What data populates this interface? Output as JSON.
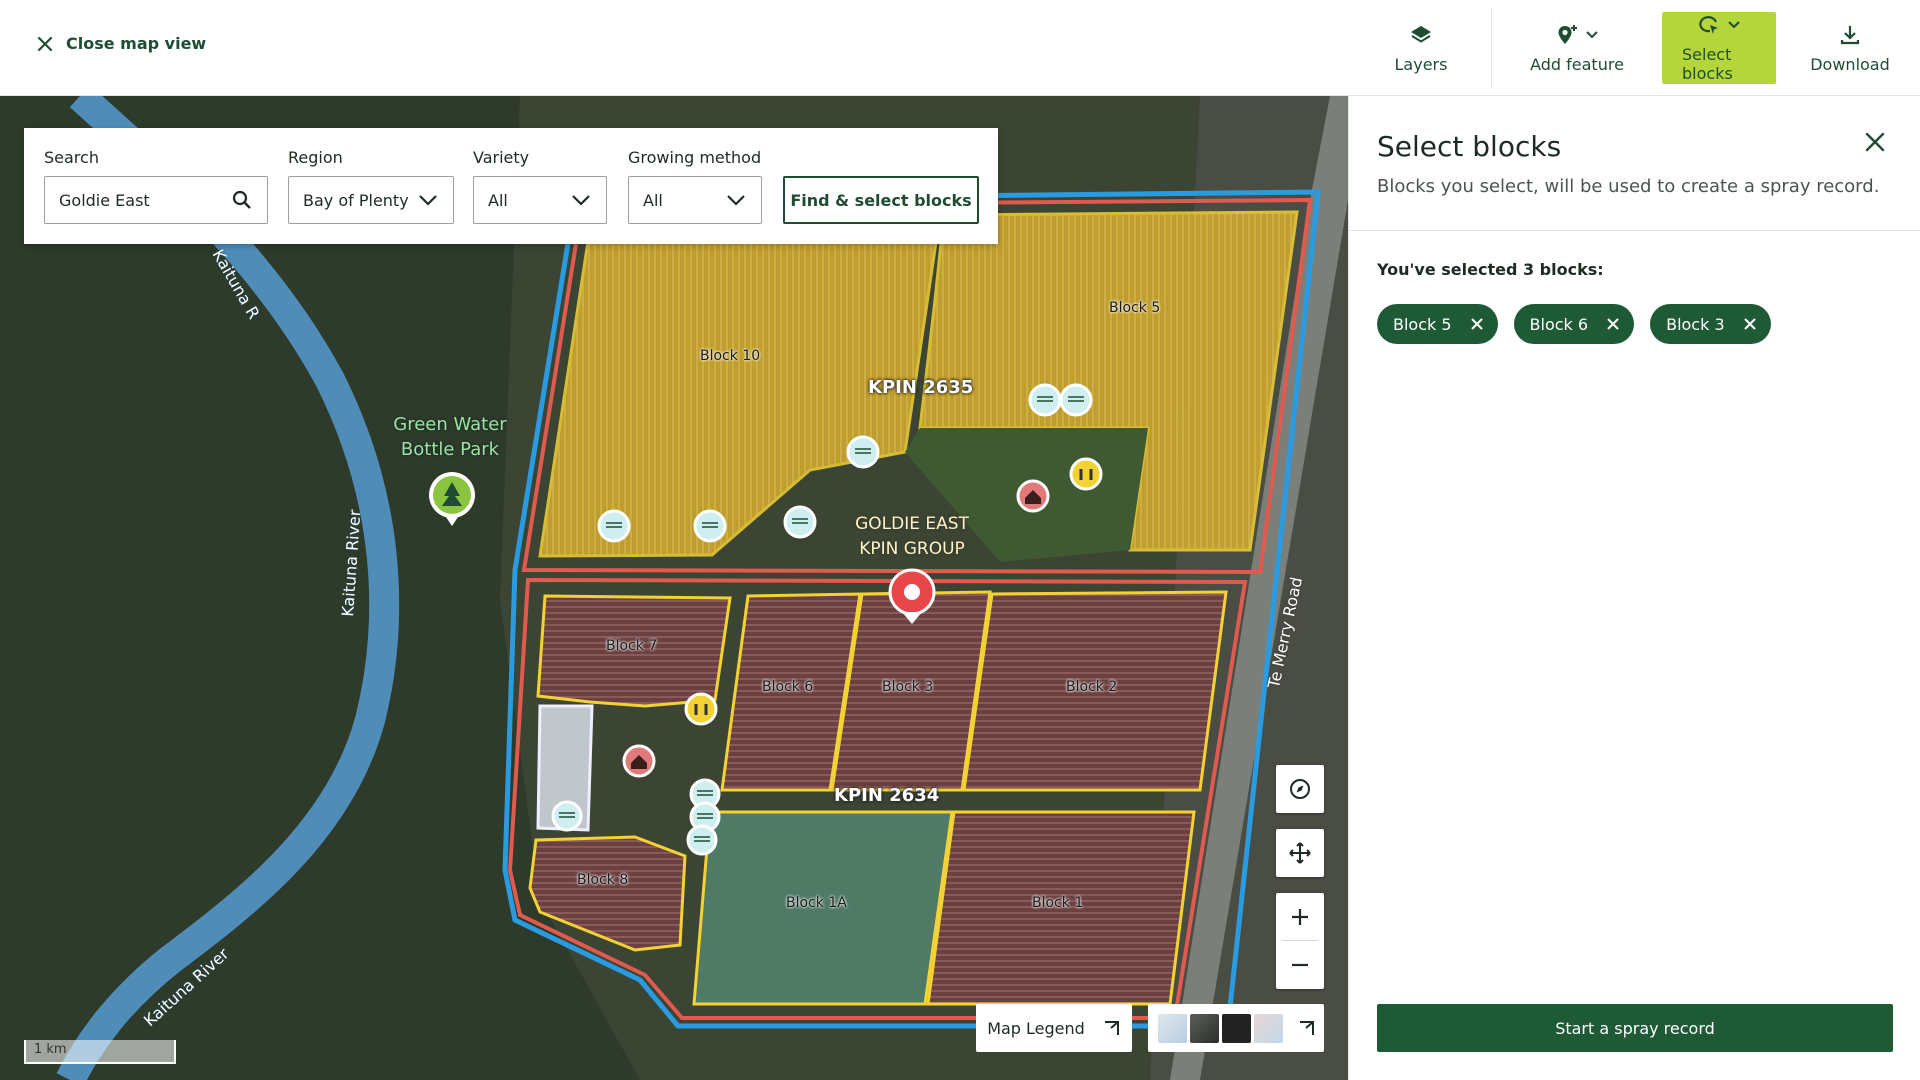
{
  "topbar": {
    "close_label": "Close map view",
    "tools": {
      "layers": "Layers",
      "add_feature": "Add feature",
      "select_blocks": "Select blocks",
      "download": "Download"
    },
    "active_color": "#b4d63a"
  },
  "filters": {
    "search": {
      "label": "Search",
      "value": "Goldie East"
    },
    "region": {
      "label": "Region",
      "value": "Bay of Plenty"
    },
    "variety": {
      "label": "Variety",
      "value": "All"
    },
    "growing_method": {
      "label": "Growing method",
      "value": "All"
    },
    "find_button": "Find & select blocks"
  },
  "map": {
    "blocks": {
      "block10": "Block 10",
      "block5": "Block 5",
      "block7": "Block 7",
      "block6": "Block 6",
      "block3": "Block 3",
      "block2": "Block 2",
      "block8": "Block 8",
      "block1a": "Block 1A",
      "block1": "Block 1"
    },
    "kpin_top": "KPIN 2635",
    "kpin_bottom": "KPIN 2634",
    "group_line1": "GOLDIE EAST",
    "group_line2": "KPIN GROUP",
    "park_line1": "Green Water",
    "park_line2": "Bottle Park",
    "river_label": "Kaituna River",
    "river_label_top": "Kaituna R",
    "road_label": "Te Merry Road",
    "scale": "1 km",
    "legend_button": "Map Legend",
    "colors": {
      "selected_fill": "#e0b634",
      "block_outline": "#f2d235",
      "kpin_outline": "#e05a4f",
      "group_outline": "#2a9be0",
      "river": "#4f8db8"
    }
  },
  "panel": {
    "title": "Select blocks",
    "subtitle": "Blocks you select, will be used to create a spray record.",
    "selected_count_text": "You've selected 3 blocks:",
    "chips": [
      "Block 5",
      "Block 6",
      "Block 3"
    ],
    "primary_button": "Start a spray record",
    "primary_color": "#1f5a37"
  }
}
